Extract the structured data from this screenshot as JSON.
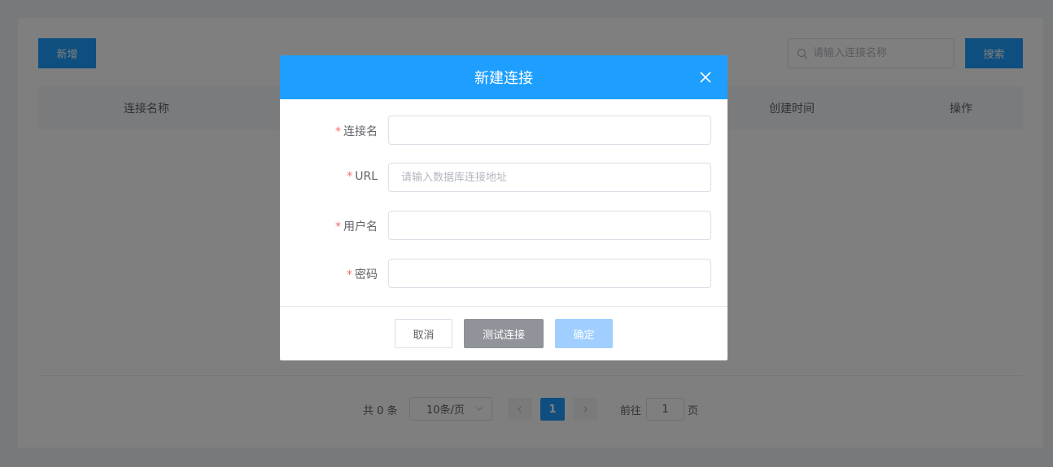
{
  "toolbar": {
    "add_label": "新增",
    "search_placeholder": "请输入连接名称",
    "search_label": "搜索"
  },
  "table": {
    "columns": [
      "连接名称",
      "创建时间",
      "操作"
    ]
  },
  "pagination": {
    "total_text": "共 0 条",
    "page_size": "10条/页",
    "current_page": "1",
    "goto_label": "前往",
    "goto_value": "1",
    "page_suffix": "页"
  },
  "dialog": {
    "title": "新建连接",
    "fields": [
      {
        "required_mark": "*",
        "label": "连接名",
        "value": "",
        "placeholder": ""
      },
      {
        "required_mark": "*",
        "label": "URL",
        "value": "",
        "placeholder": "请输入数据库连接地址"
      },
      {
        "required_mark": "*",
        "label": "用户名",
        "value": "",
        "placeholder": ""
      },
      {
        "required_mark": "*",
        "label": "密码",
        "value": "",
        "placeholder": ""
      }
    ],
    "buttons": {
      "cancel": "取消",
      "test": "测试连接",
      "confirm": "确定"
    }
  },
  "colors": {
    "primary": "#1e9fff",
    "required": "#f56c6c",
    "test_button": "#909399",
    "confirm_disabled": "#a0cfff"
  },
  "icons": {
    "search": "search-icon",
    "close": "close-icon",
    "select_arrow": "chevron-down-icon",
    "prev": "chevron-left-icon",
    "next": "chevron-right-icon"
  }
}
